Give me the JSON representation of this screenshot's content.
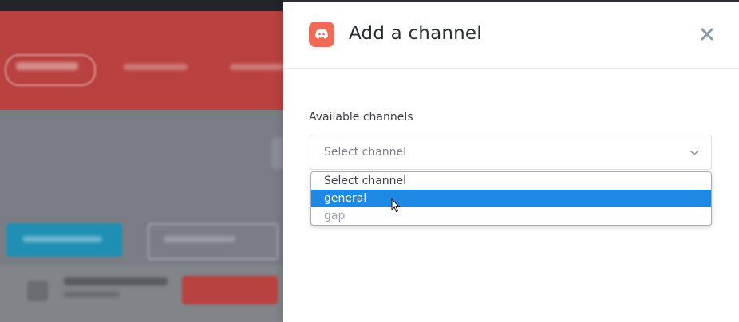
{
  "modal": {
    "title": "Add a channel",
    "field_label": "Available channels",
    "select": {
      "value": "Select channel",
      "options": [
        {
          "label": "Select channel"
        },
        {
          "label": "general"
        },
        {
          "label": "gap"
        }
      ],
      "highlighted": "general"
    },
    "icons": {
      "brand": "discord-icon",
      "close": "close-icon",
      "chevron": "chevron-down-icon"
    }
  },
  "colors": {
    "brand": "#f06a55",
    "highlight": "#1e88e5",
    "background_red": "#b9413f",
    "background_teal": "#1f8fb3"
  }
}
